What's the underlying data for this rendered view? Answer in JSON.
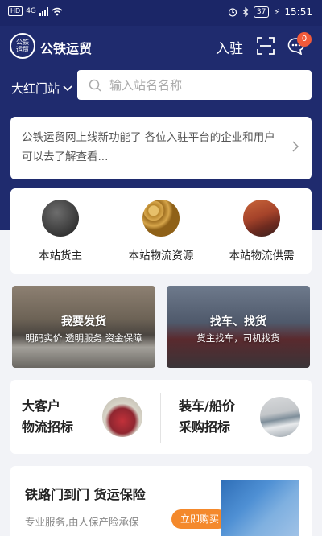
{
  "status_bar": {
    "hd": "HD",
    "network": "4G",
    "battery": "37",
    "time": "15:51"
  },
  "header": {
    "logo_text": "公铁\n运贸",
    "brand": "公铁运贸",
    "join_label": "入驻",
    "message_badge": "0"
  },
  "search": {
    "station": "大红门站",
    "placeholder": "输入站名名称"
  },
  "notice": {
    "text": "公铁运贸网上线新功能了 各位入驻平台的企业和用户可以去了解查看..."
  },
  "quick_links": [
    {
      "label": "本站货主"
    },
    {
      "label": "本站物流资源"
    },
    {
      "label": "本站物流供需"
    }
  ],
  "banners": [
    {
      "title": "我要发货",
      "subtitle": "明码实价 透明服务 资金保障"
    },
    {
      "title": "找车、找货",
      "subtitle": "货主找车，司机找货"
    }
  ],
  "bids": [
    {
      "line1": "大客户",
      "line2": "物流招标"
    },
    {
      "line1": "装车/船价",
      "line2": "采购招标"
    }
  ],
  "insurance": {
    "title": "铁路门到门 货运保险",
    "subtitle": "专业服务,由人保产险承保",
    "button": "立即购买"
  },
  "colors": {
    "header_bg": "#1f2b6e",
    "accent": "#f4892c",
    "badge": "#f25a3a"
  }
}
